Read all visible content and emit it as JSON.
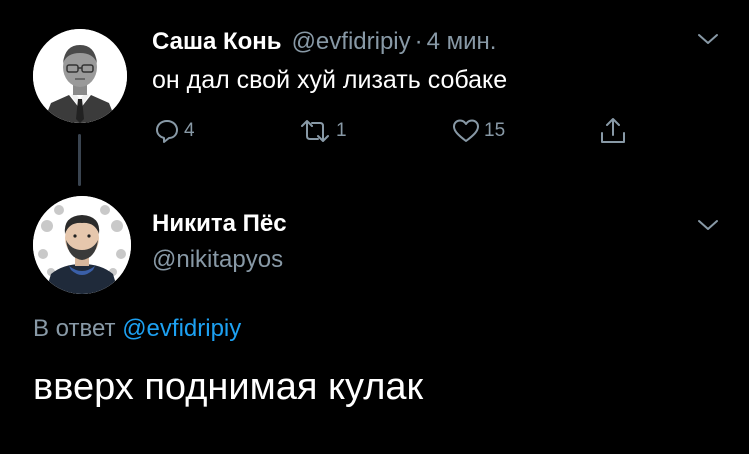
{
  "parent_tweet": {
    "author_name": "Саша Конь",
    "author_handle": "@evfidripiy",
    "separator": "·",
    "timestamp": "4 мин.",
    "text": "он дал свой хуй лизать собаке",
    "reply_count": "4",
    "retweet_count": "1",
    "like_count": "15"
  },
  "reply_tweet": {
    "author_name": "Никита Пёс",
    "author_handle": "@nikitapyos",
    "in_reply_prefix": "В ответ",
    "in_reply_mention": "@evfidripiy",
    "text": "вверх поднимая кулак"
  },
  "colors": {
    "background": "#000000",
    "text_primary": "#ffffff",
    "text_muted": "#8899a6",
    "link": "#1da1f2"
  }
}
